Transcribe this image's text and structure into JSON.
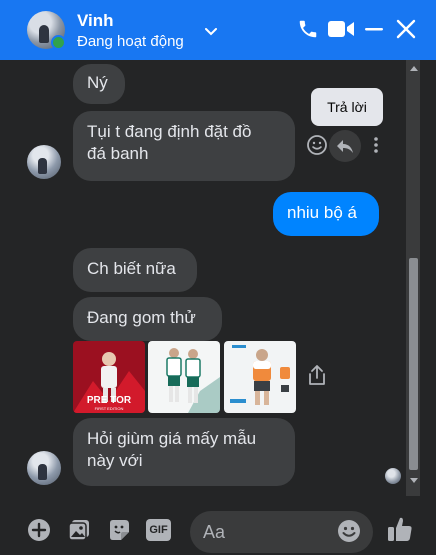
{
  "header": {
    "name": "Vinh",
    "status": "Đang hoạt động",
    "icons": [
      "phone-icon",
      "video-icon",
      "minimize-icon",
      "close-icon"
    ]
  },
  "messages": {
    "m1": "Ný",
    "m2": [
      "Tụi t đang định đặt đồ",
      "đá banh"
    ],
    "m3": "nhiu bộ á",
    "m4": "Ch biết nữa",
    "m5": "Đang gom thử",
    "m6": [
      "Hỏi giùm giá mấy mẫu",
      "này với"
    ]
  },
  "tooltip": {
    "reply_label": "Trả lời"
  },
  "photos": {
    "photo1_text": "PRE  TOR",
    "photo1_subtext": "FIRST EDITION"
  },
  "composer": {
    "placeholder": "Aa",
    "gif_label": "GIF"
  },
  "colors": {
    "header": "#1877f2",
    "my_bubble": "#0084ff",
    "their_bubble": "#3e4042",
    "background": "#242526"
  }
}
